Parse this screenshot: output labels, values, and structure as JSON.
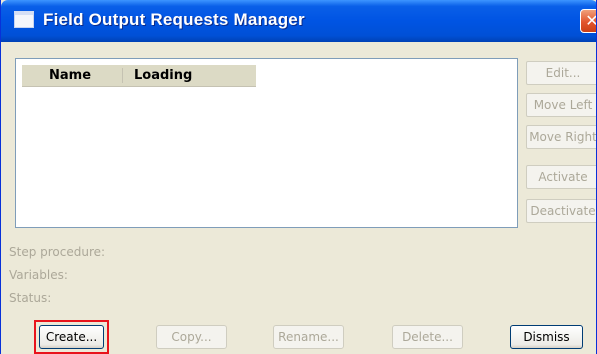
{
  "window": {
    "title": "Field Output Requests Manager",
    "close_glyph": "✕",
    "title_icon": "window-icon"
  },
  "list": {
    "columns": [
      "Name",
      "Loading"
    ],
    "rows": []
  },
  "side_buttons": {
    "edit": "Edit...",
    "move_left": "Move Left",
    "move_right": "Move Right",
    "activate": "Activate",
    "deactivate": "Deactivate"
  },
  "info": {
    "step_procedure": "Step procedure:",
    "variables": "Variables:",
    "status": "Status:"
  },
  "bottom_buttons": {
    "create": "Create...",
    "copy": "Copy...",
    "rename": "Rename...",
    "delete": "Delete...",
    "dismiss": "Dismiss"
  },
  "colors": {
    "title_bar": "#0054e3",
    "highlight": "#e8141c",
    "disabled_text": "#aca899"
  }
}
